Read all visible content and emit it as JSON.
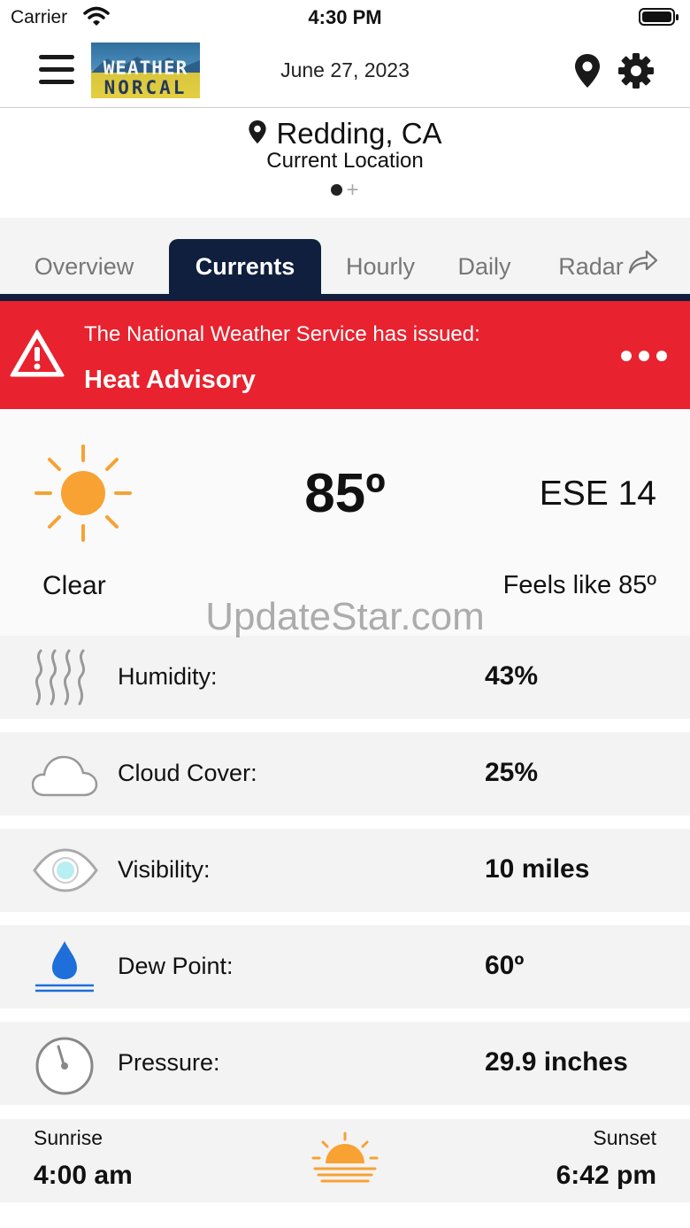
{
  "status_bar": {
    "carrier": "Carrier",
    "time": "4:30 PM"
  },
  "header": {
    "logo_line1": "WEATHER",
    "logo_line2": "NORCAL",
    "date": "June 27, 2023"
  },
  "location": {
    "city": "Redding, CA",
    "subtitle": "Current Location",
    "add_page": "+"
  },
  "tabs": [
    {
      "label": "Overview",
      "active": false
    },
    {
      "label": "Currents",
      "active": true
    },
    {
      "label": "Hourly",
      "active": false
    },
    {
      "label": "Daily",
      "active": false
    },
    {
      "label": "Radar",
      "active": false
    }
  ],
  "alert": {
    "issuer_text": "The National Weather Service has issued:",
    "title": "Heat Advisory",
    "color": "#e8222e"
  },
  "current": {
    "temperature": "85º",
    "wind": "ESE 14",
    "condition": "Clear",
    "feels_like": "Feels like 85º"
  },
  "watermark": "UpdateStar.com",
  "details": [
    {
      "icon": "humidity-icon",
      "label": "Humidity:",
      "value": "43%"
    },
    {
      "icon": "cloud-icon",
      "label": "Cloud Cover:",
      "value": "25%"
    },
    {
      "icon": "eye-icon",
      "label": "Visibility:",
      "value": "10 miles"
    },
    {
      "icon": "dew-drop-icon",
      "label": "Dew Point:",
      "value": "60º"
    },
    {
      "icon": "pressure-gauge-icon",
      "label": "Pressure:",
      "value": "29.9 inches"
    }
  ],
  "sun": {
    "sunrise_label": "Sunrise",
    "sunrise_time": "4:00 am",
    "sunset_label": "Sunset",
    "sunset_time": "6:42 pm"
  },
  "colors": {
    "navy": "#0f1f3d",
    "sun_orange": "#f7a233",
    "drop_blue": "#1e6fd9"
  }
}
